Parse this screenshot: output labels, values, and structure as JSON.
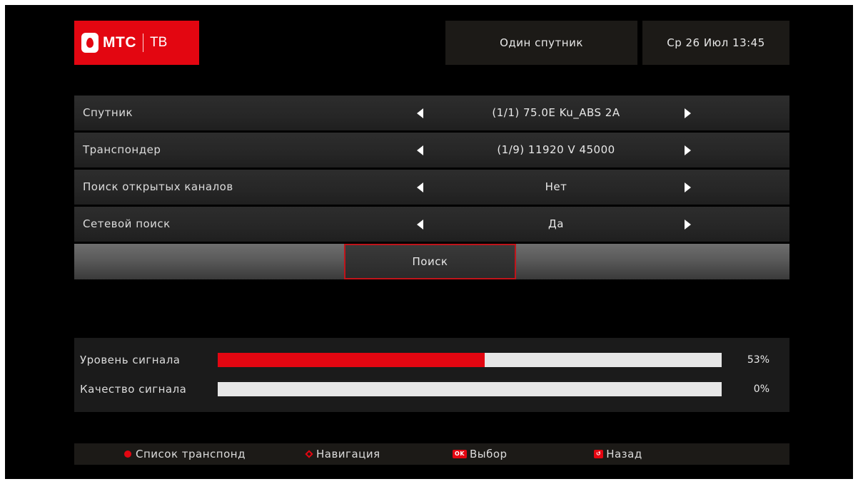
{
  "header": {
    "logo_brand": "МТС",
    "logo_product": "ТВ",
    "mode": "Один спутник",
    "datetime": "Ср  26 Июл 13:45"
  },
  "settings": {
    "rows": [
      {
        "label": "Спутник",
        "value": "(1/1)  75.0E  Ku_ABS 2A"
      },
      {
        "label": "Транспондер",
        "value": "(1/9) 11920 V 45000"
      },
      {
        "label": "Поиск открытых каналов",
        "value": "Нет"
      },
      {
        "label": "Сетевой поиск",
        "value": "Да"
      }
    ],
    "search_button": "Поиск"
  },
  "signal": {
    "level": {
      "label": "Уровень сигнала",
      "percent": 53,
      "text": "53%"
    },
    "quality": {
      "label": "Качество сигнала",
      "percent": 0,
      "text": "0%"
    }
  },
  "footer": {
    "hints": [
      {
        "icon": "red-dot-icon",
        "label": "Список транспонд"
      },
      {
        "icon": "navigation-icon",
        "label": "Навигация"
      },
      {
        "icon": "ok-key-icon",
        "key": "OK",
        "label": "Выбор"
      },
      {
        "icon": "back-key-icon",
        "key": "↺",
        "label": "Назад"
      }
    ]
  },
  "colors": {
    "accent": "#e30611",
    "background": "#000000",
    "panel": "#1c1a17"
  }
}
